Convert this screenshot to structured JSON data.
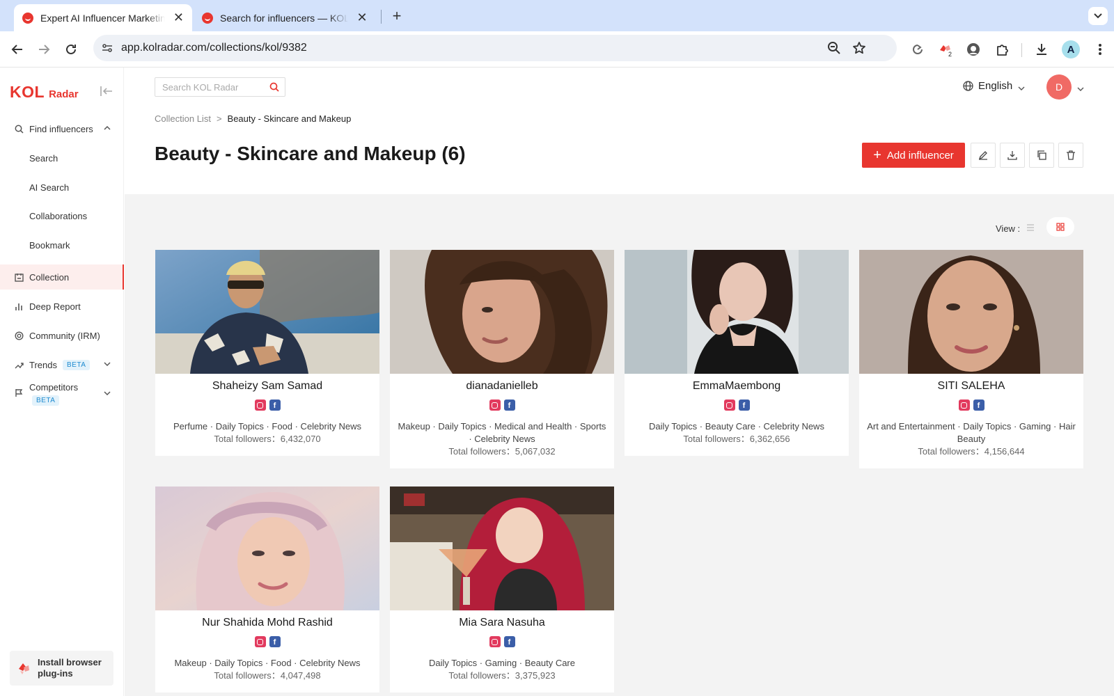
{
  "browser": {
    "tabs": [
      {
        "title": "Expert AI Influencer Marketing"
      },
      {
        "title": "Search for influencers — KOL Radar"
      }
    ],
    "url": "app.kolradar.com/collections/kol/9382",
    "profile_initial": "A",
    "ext_badge": "2"
  },
  "sidebar": {
    "logo_main": "KOL",
    "logo_sub": "Radar",
    "find_influencers": "Find influencers",
    "sub_items": [
      "Search",
      "AI Search",
      "Collaborations",
      "Bookmark"
    ],
    "collection": "Collection",
    "deep_report": "Deep Report",
    "community": "Community (IRM)",
    "trends": "Trends",
    "competitors": "Competitors",
    "beta": "BETA",
    "plugin_label": "Install browser plug-ins"
  },
  "header": {
    "search_placeholder": "Search KOL Radar",
    "language": "English",
    "user_initial": "D"
  },
  "breadcrumb": {
    "root": "Collection List",
    "sep": ">",
    "current": "Beauty - Skincare and Makeup"
  },
  "page": {
    "title": "Beauty - Skincare and Makeup (6)",
    "add_button": "Add influencer",
    "view_label": "View :"
  },
  "influencers": [
    {
      "name": "Shaheizy Sam Samad",
      "categories": "Perfume · Daily Topics · Food · Celebrity News",
      "followers": "Total followers：6,432,070"
    },
    {
      "name": "dianadanielleb",
      "categories": "Makeup · Daily Topics · Medical and Health · Sports · Celebrity News",
      "followers": "Total followers：5,067,032"
    },
    {
      "name": "EmmaMaembong",
      "categories": "Daily Topics · Beauty Care · Celebrity News",
      "followers": "Total followers：6,362,656"
    },
    {
      "name": "SITI SALEHA",
      "categories": "Art and Entertainment · Daily Topics · Gaming · Hair Beauty",
      "followers": "Total followers：4,156,644"
    },
    {
      "name": "Nur Shahida Mohd Rashid",
      "categories": "Makeup · Daily Topics · Food · Celebrity News",
      "followers": "Total followers：4,047,498"
    },
    {
      "name": "Mia Sara Nasuha",
      "categories": "Daily Topics · Gaming · Beauty Care",
      "followers": "Total followers：3,375,923"
    }
  ],
  "colors": {
    "brand": "#e8362f",
    "instagram": "#e23a5e",
    "facebook": "#3b5ea8"
  }
}
